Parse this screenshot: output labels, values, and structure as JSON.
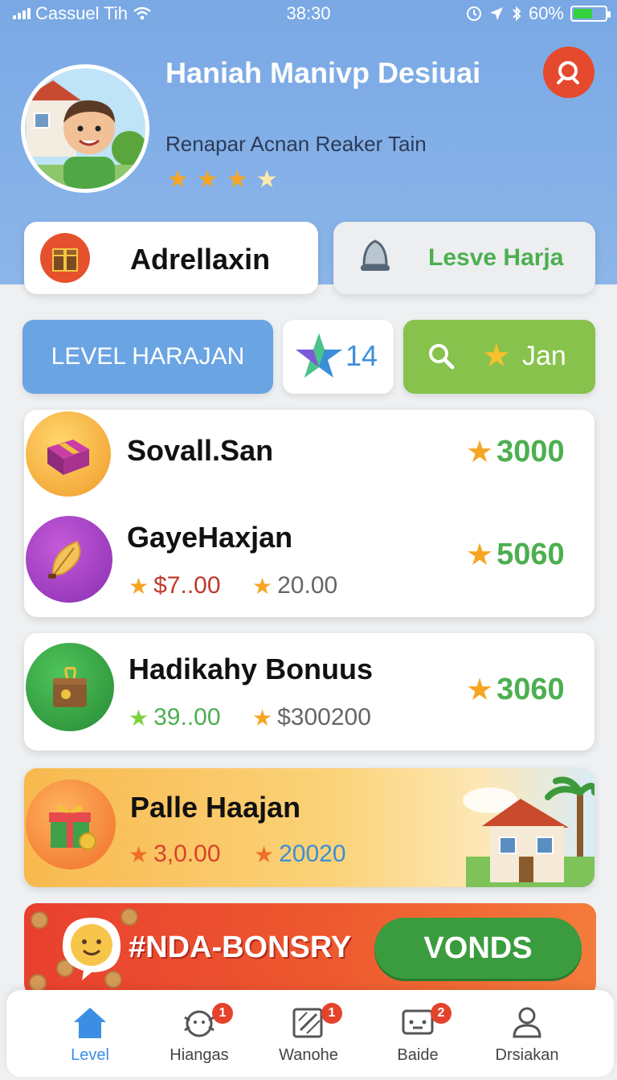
{
  "status_bar": {
    "carrier": "Cassuel Tih",
    "time": "38:30",
    "battery": "60%"
  },
  "profile": {
    "name": "Haniah Manivp Desiuai",
    "subtitle": "Renapar Acnan Reaker Tain",
    "rating": 3,
    "rating_max": 4
  },
  "actions": {
    "primary_label": "Adrellaxin",
    "secondary_label": "Lesve Harja"
  },
  "level_row": {
    "level_label": "LEVEL HARAJAN",
    "level_number": "14",
    "filter_label": "Jan"
  },
  "rewards": [
    {
      "title": "Sovall.San",
      "value": "3000"
    },
    {
      "title": "GayeHaxjan",
      "value": "5060",
      "price": "$7..00",
      "points": "20.00"
    }
  ],
  "bonus": {
    "title": "Hadikahy Bonuus",
    "value": "3060",
    "price": "39..00",
    "points": "$300200"
  },
  "promo": {
    "title": "Palle Haajan",
    "price": "3,0.00",
    "points": "20020"
  },
  "banner": {
    "title": "#NDA-BONSRY",
    "button_label": "VONDS"
  },
  "bottom_nav": [
    {
      "label": "Level",
      "badge": ""
    },
    {
      "label": "Hiangas",
      "badge": "1"
    },
    {
      "label": "Wanohe",
      "badge": "1"
    },
    {
      "label": "Baide",
      "badge": "2"
    },
    {
      "label": "Drsiakan",
      "badge": ""
    }
  ],
  "colors": {
    "header": "#79a8e4",
    "accent_green": "#4caf50",
    "accent_red": "#e64a2e",
    "star": "#f6a623",
    "nav_active": "#3b8ee3"
  }
}
